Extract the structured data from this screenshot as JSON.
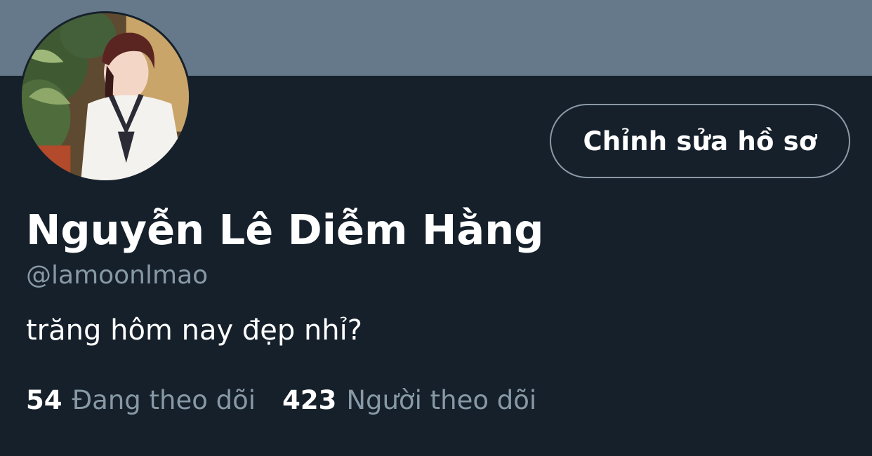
{
  "profile": {
    "display_name": "Nguyễn Lê Diễm Hằng",
    "handle": "@lamoonlmao",
    "bio": "trăng hôm nay đẹp nhỉ?",
    "edit_button_label": "Chỉnh sửa hồ sơ",
    "following_count": "54",
    "following_label": "Đang theo dõi",
    "followers_count": "423",
    "followers_label": "Người theo dõi"
  },
  "colors": {
    "background": "#15202b",
    "banner": "#66798a",
    "secondary_text": "#8899a6",
    "button_border": "#8b98a5"
  }
}
